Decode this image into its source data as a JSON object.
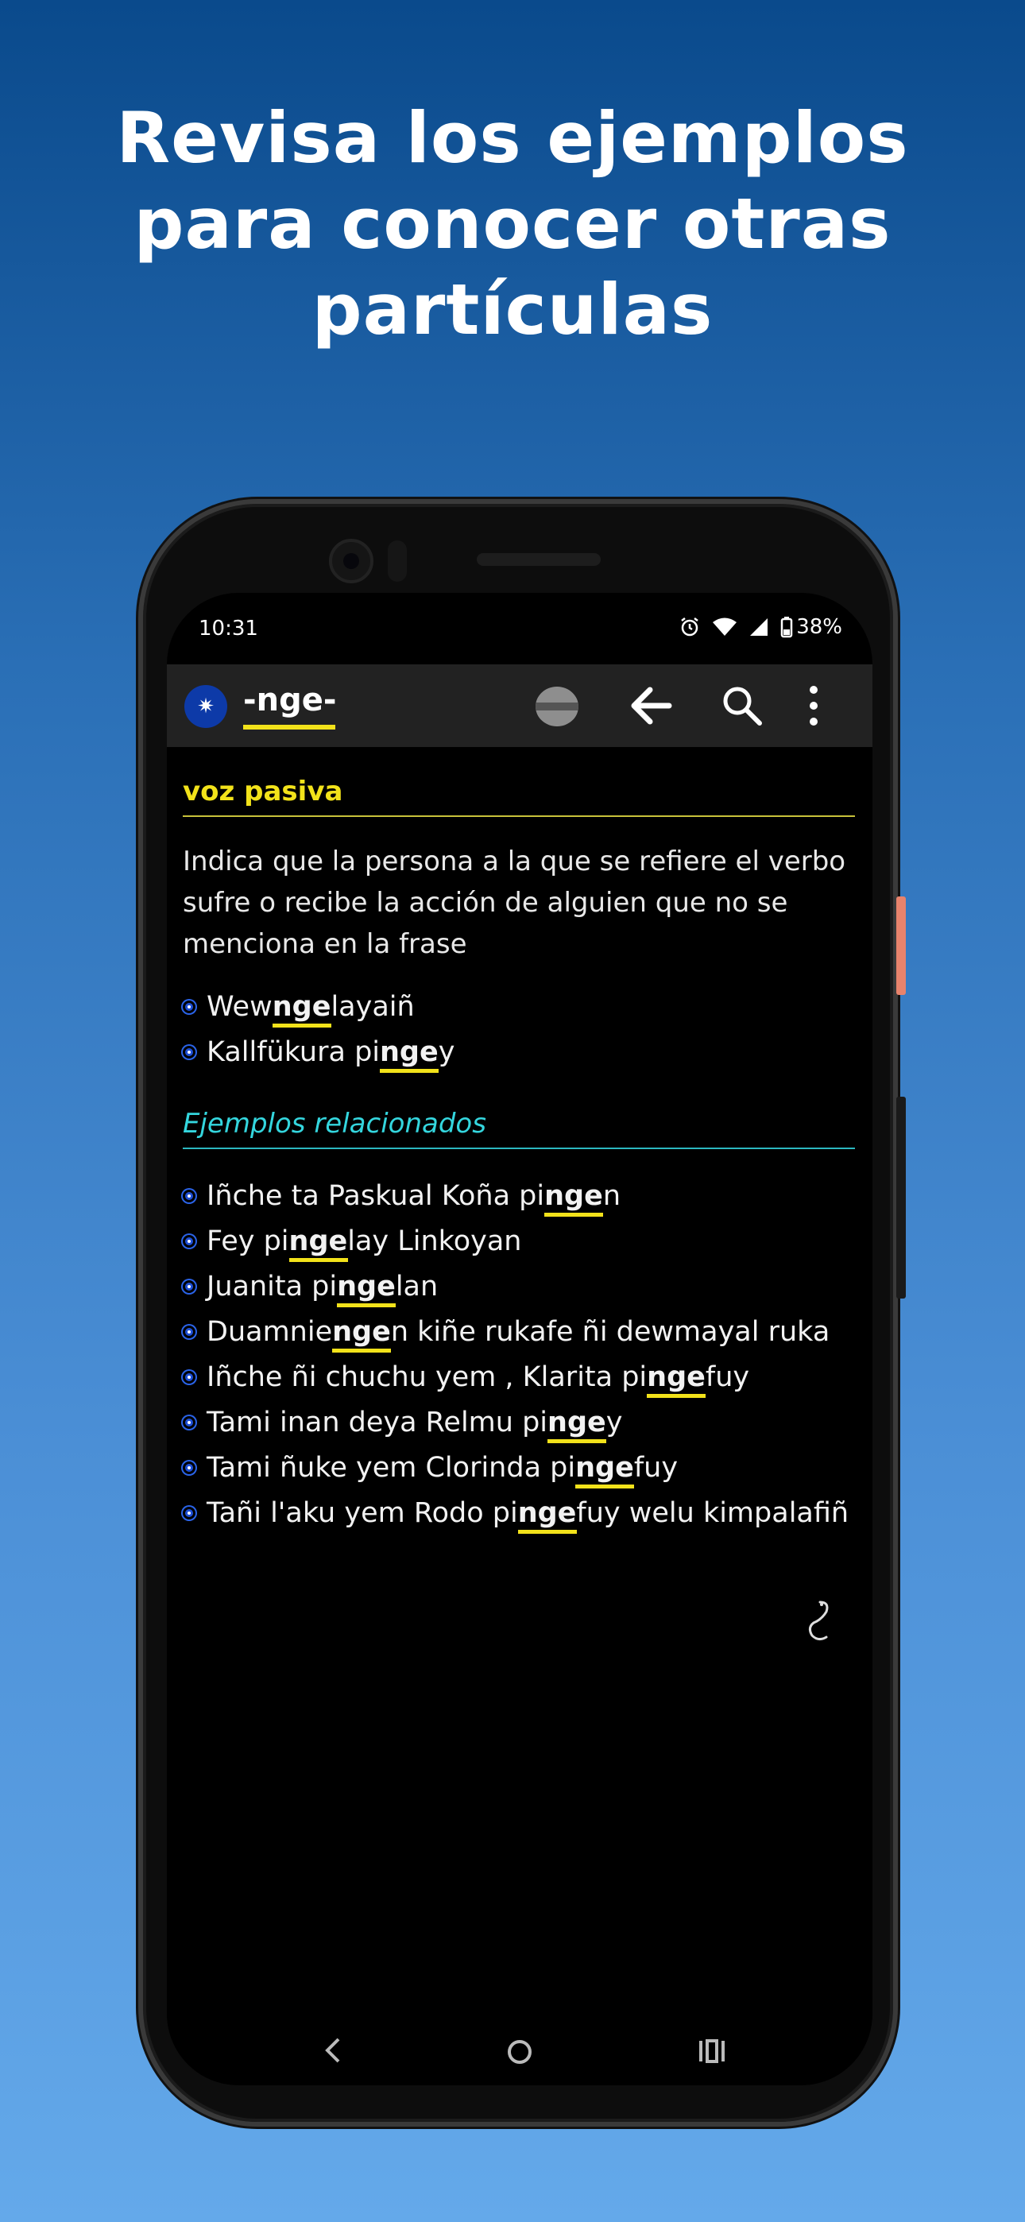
{
  "headline": [
    "Revisa los ejemplos",
    "para conocer otras",
    "partículas"
  ],
  "status": {
    "time": "10:31",
    "battery": "38%"
  },
  "appbar": {
    "title": "-nge-",
    "logo": "mapuche-star-icon"
  },
  "entry": {
    "heading": "voz pasiva",
    "description": "Indica que la persona a la que se refiere el verbo sufre o recibe la acción de alguien que no se menciona en la frase",
    "examples": [
      "Wewngelayaiñ",
      "Kallfükura pingey"
    ]
  },
  "related": {
    "heading": "Ejemplos relacionados",
    "items": [
      "Iñche ta Paskual Koña pingen",
      "Fey pingelay Linkoyan",
      "Juanita pingelan",
      "Duamniengen kiñe rukafe ñi dewmayal ruka",
      "Iñche ñi chuchu yem , Klarita pingefuy",
      "Tami inan deya Relmu pingey",
      "Tami ñuke yem Clorinda pingefuy",
      "Tañi l'aku yem Rodo pingefuy welu kimpalafiñ"
    ]
  },
  "colors": {
    "particle_yellow": "#f2e21a",
    "negation_red": "#d51515",
    "person_blue": "#2a86e8",
    "accent_cyan": "#34d6de"
  }
}
